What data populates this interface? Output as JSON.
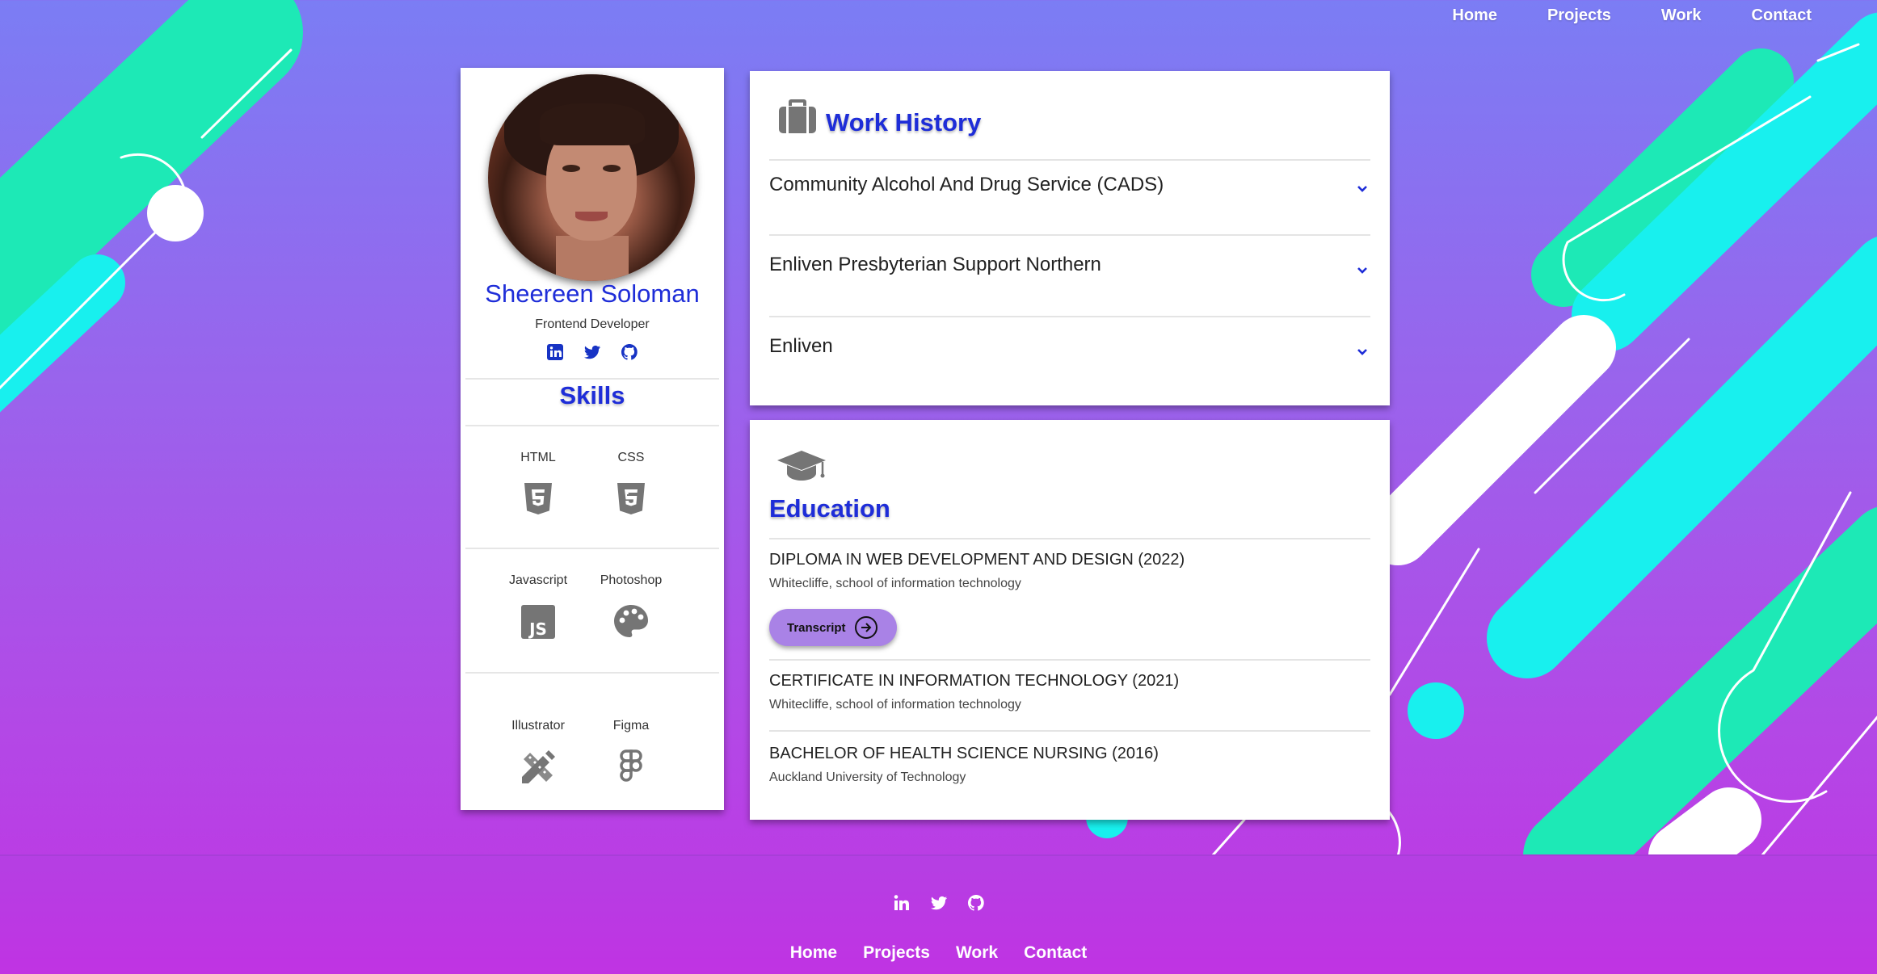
{
  "nav": {
    "items": [
      "Home",
      "Projects",
      "Work",
      "Contact"
    ]
  },
  "profile": {
    "name": "Sheereen Soloman",
    "role": "Frontend Developer",
    "social_icons": [
      "linkedin-icon",
      "twitter-icon",
      "github-icon"
    ]
  },
  "skills": {
    "title": "Skills",
    "items": [
      {
        "label": "HTML",
        "icon": "html5-icon"
      },
      {
        "label": "CSS",
        "icon": "css3-icon"
      },
      {
        "label": "Javascript",
        "icon": "js-icon"
      },
      {
        "label": "Photoshop",
        "icon": "palette-icon"
      },
      {
        "label": "Illustrator",
        "icon": "pencil-ruler-icon"
      },
      {
        "label": "Figma",
        "icon": "figma-icon"
      }
    ]
  },
  "work": {
    "title": "Work History",
    "icon": "briefcase-icon",
    "items": [
      "Community Alcohol And Drug Service (CADS)",
      "Enliven Presbyterian Support Northern",
      "Enliven"
    ]
  },
  "education": {
    "title": "Education",
    "icon": "graduation-cap-icon",
    "items": [
      {
        "degree": "DIPLOMA IN WEB DEVELOPMENT AND DESIGN (2022)",
        "school": "Whitecliffe, school of information technology",
        "button": "Transcript"
      },
      {
        "degree": "CERTIFICATE IN INFORMATION TECHNOLOGY (2021)",
        "school": "Whitecliffe, school of information technology"
      },
      {
        "degree": "BACHELOR OF HEALTH SCIENCE NURSING (2016)",
        "school": "Auckland University of Technology"
      }
    ]
  },
  "footer": {
    "social_icons": [
      "linkedin-icon",
      "twitter-icon",
      "github-icon"
    ],
    "nav": [
      "Home",
      "Projects",
      "Work",
      "Contact"
    ]
  },
  "colors": {
    "accent_blue": "#1e2dd8",
    "mint": "#1de9b6",
    "cyan": "#18f0ee",
    "button": "#a982e6"
  }
}
